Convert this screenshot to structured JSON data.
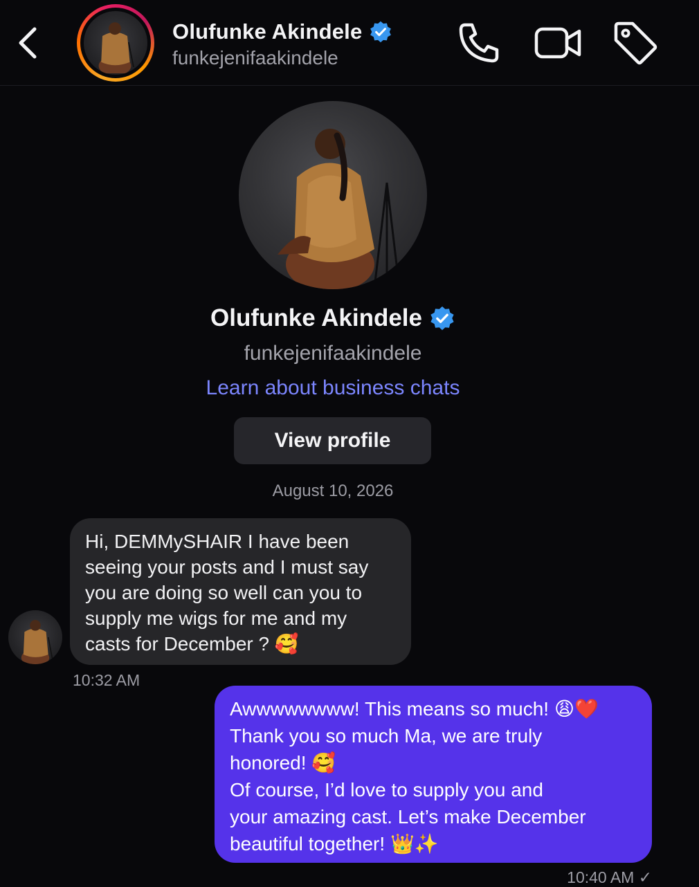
{
  "header": {
    "back_icon": "chevron-left-icon",
    "name": "Olufunke Akindele",
    "username": "funkejenifaakindele",
    "verified_icon": "verified-badge-icon",
    "actions": [
      "phone-icon",
      "video-camera-icon",
      "tag-icon"
    ]
  },
  "profile": {
    "name": "Olufunke Akindele",
    "username": "funkejenifaakindele",
    "business_link": "Learn about business chats",
    "view_profile_label": "View profile"
  },
  "conversation": {
    "date": "August 10, 2026",
    "incoming": {
      "lines": [
        "Hi, DEMMySHAIR I have been",
        "seeing your posts and I must say",
        "you are doing so well can you to",
        "supply me wigs for me and my",
        "casts for December ? 🥰"
      ],
      "time": "10:32 AM"
    },
    "outgoing": {
      "lines": [
        "Awwwwwwww! This means so much! 😩❤️",
        "Thank you so much Ma, we are truly",
        "honored! 🥰",
        "Of course, I’d love to supply you and",
        "your amazing cast. Let’s make December",
        "beautiful together! 👑✨"
      ],
      "time": "10:40 AM ✓"
    }
  },
  "colors": {
    "background": "#08080b",
    "accent_link": "#7c86ff",
    "outgoing_bubble": "#5533ea",
    "incoming_bubble": "#262629",
    "verified": "#3897f0"
  }
}
